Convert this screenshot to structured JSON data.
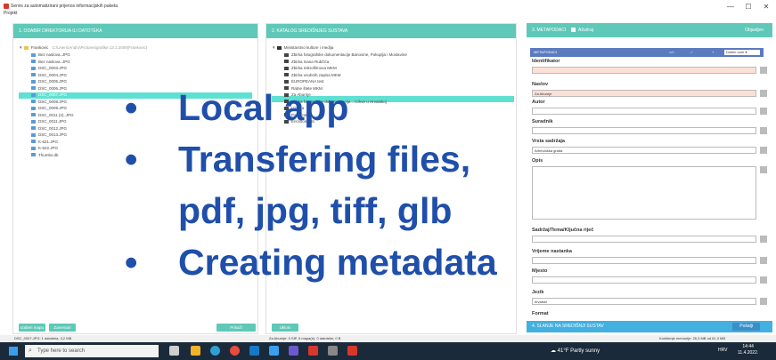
{
  "window": {
    "title": "Servis za automatizirani prijenos informacijskih paketa",
    "menu_projekt": "Projekt",
    "minimize": "—",
    "maximize": "☐",
    "close": "✕"
  },
  "panel1": {
    "title": "1. ODABIR DIREKTORIJA ILI DATOTEKA",
    "root_label": "Frankovic",
    "root_path": "C:\\Users\\Andro\\Pictures\\grafike 13.1.2009(Frankovic)",
    "files": [
      "Bez naslova..JPG",
      "Bez naslova..JPG",
      "DSC_0003.JPG",
      "DSC_0004.JPG",
      "DSC_0005.JPG",
      "DSC_0006.JPG",
      "DSC_0007.JPG",
      "DSC_0008.JPG",
      "DSC_0009.JPG",
      "DSC_0011 (2)..JPG",
      "DSC_0011.JPG",
      "DSC_0012.JPG",
      "DSC_0013.JPG",
      "K-621.JPG",
      "K-622.JPG",
      "Thumbs.db"
    ],
    "selected_index": 6,
    "btn_izaberi": "Izaberi mapu",
    "btn_zanemari": "Zanemari",
    "btn_prikazi": "Prikaži"
  },
  "panel2": {
    "title": "2. KATALOG SREDIŠNJEG SUSTAVA",
    "root_label": "Ministarstvo kulture i medija",
    "items": [
      "Zbirka fotografske dokumentacije Banovine, Pokuplja i Moslavine",
      "Zbirka Ivana Rubčića",
      "Zbirka mikrofilmova MKM",
      "Zbirka osobnih zapisa MKM",
      "EUROPEANA test",
      "Ratne štete MKM",
      "Za Aburnje",
      "Zbirka fotografske dokumentacije... Crkve u Hrvatskoj",
      "Izložba",
      "Pano(ratni)",
      "Ericsson test"
    ],
    "selected_index": 6,
    "btn_ukloni": "Ukloni"
  },
  "panel3": {
    "title": "3. METAPODACI",
    "checkbox_label": "Ažuriraj",
    "objavljen": "Objavljen",
    "subbar_label": "METAPODACI",
    "code_icon": "</>",
    "check_icon": "✓",
    "plus_icon": "+",
    "select_value": "Dublin core",
    "fields": {
      "identifikator": "Identifikator",
      "naslov": "Naslov",
      "naslov_value": "Za Aburnje",
      "autor": "Autor",
      "suradnik": "Suradnik",
      "vrsta": "Vrsta sadržaja",
      "vrsta_value": "Arheološka građa",
      "opis": "Opis",
      "sadrzaj": "Sadržaj/Tema/Ključna riječ",
      "nastanka": "Vrijeme nastanka",
      "mjesto": "Mjesto",
      "jezik": "Jezik",
      "jezik_value": "hrvatski",
      "format": "Format"
    },
    "slanje_title": "4. SLANJE NA SREDIŠNJI SUSTAV",
    "btn_posalji": "Pošalji"
  },
  "status": {
    "left": "DSC_0007.JPG: 1 datoteka, 3,2 MB",
    "middle": "Za Aburnje: 0 SIP, 0 mapa(e), 0 datoteke, 0 B",
    "right": "Korištenje memorije: 26,3 MB od 61,3 MB"
  },
  "overlay": {
    "line1": "Local app",
    "line2": "Transfering files,",
    "line3": "pdf, jpg, tiff, glb",
    "line4": "Creating metadata",
    "bullet": "•"
  },
  "taskbar": {
    "search_placeholder": "Type here to search",
    "weather": "41°F  Partly sunny",
    "lang": "HRV",
    "time": "14:44",
    "date": "11.4.2022."
  }
}
